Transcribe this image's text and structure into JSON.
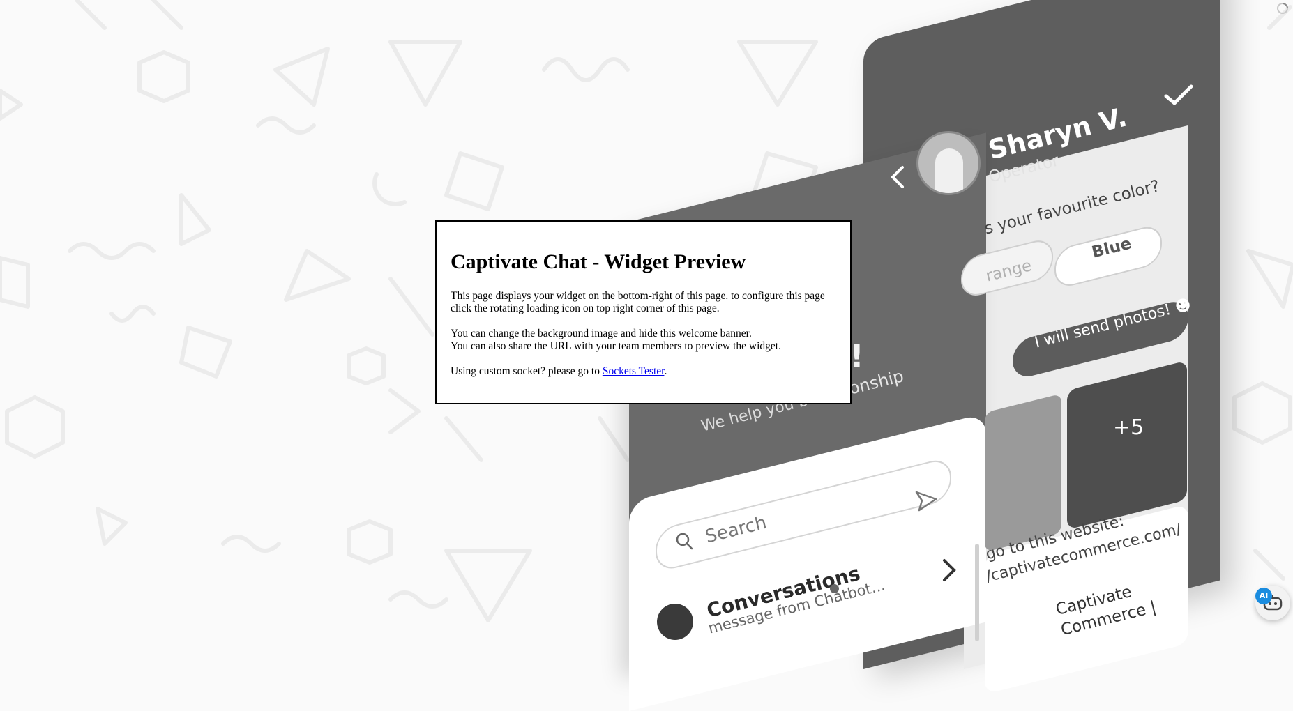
{
  "banner": {
    "title": "Captivate Chat - Widget Preview",
    "para1": "This page displays your widget on the bottom-right of this page. to configure this page click the rotating loading icon on top right corner of this page.",
    "para2_line1": "You can change the background image and hide this welcome banner.",
    "para2_line2": "You can also share the URL with your team members to preview the widget.",
    "para3_prefix": "Using custom socket? please go to ",
    "link_text": "Sockets Tester",
    "para3_suffix": "."
  },
  "mockup": {
    "operator_name": "Sharyn V.",
    "operator_role": "Operator",
    "question": "s your favourite color?",
    "option_left": "range",
    "option_right": "Blue",
    "bubble": "I will send photos! ☻",
    "photos_more": "+5",
    "link_line1": "go to this website:",
    "link_line2": "/captivatecommerce.com/",
    "preview_title_line1": "Captivate",
    "preview_title_line2": "Commerce |",
    "exclaim": "!",
    "onship": "onship",
    "tagline": "We help you bu",
    "search_placeholder": "Search",
    "conversations_title": "Conversations",
    "conversations_sub": "message from Chatbot..."
  },
  "launcher": {
    "badge": "AI"
  },
  "colors": {
    "link": "#0000ee",
    "badge": "#1a8cdf",
    "panel_dark": "#5e5e5e"
  }
}
